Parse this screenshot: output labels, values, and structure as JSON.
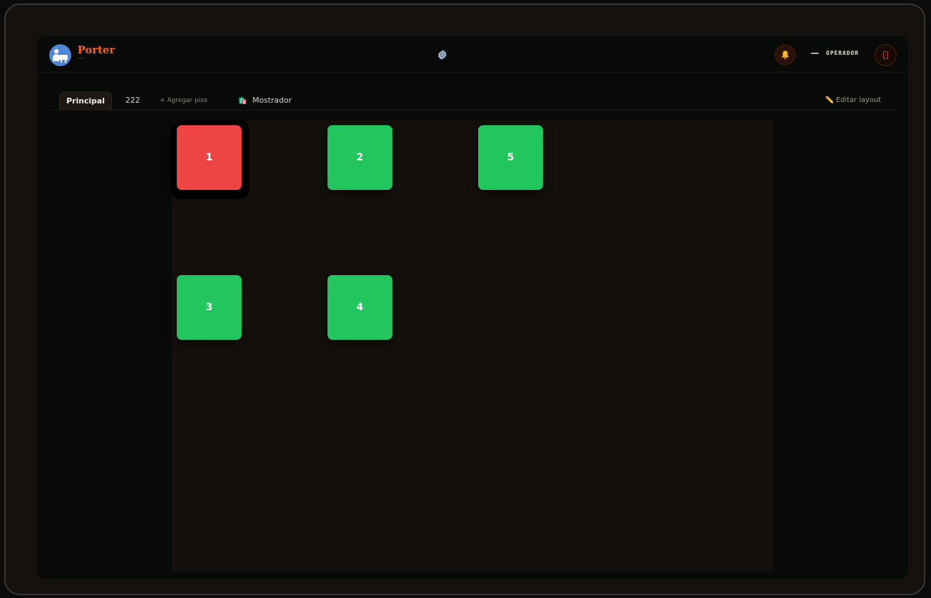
{
  "brand": {
    "name": "Porter",
    "subtitle": "—"
  },
  "header": {
    "settings_icon": "gear-icon",
    "notifications_icon": "bell-icon",
    "user_dash": "—",
    "user_role": "OPERADOR",
    "logout_icon": "logout-icon"
  },
  "tabs": {
    "items": [
      {
        "label": "Principal",
        "active": true
      },
      {
        "label": "222",
        "active": false
      }
    ],
    "add_floor": "+ Agregar piso",
    "counter_icon": "shopping-bag-icon",
    "counter": "Mostrador",
    "edit_layout": "Editar layout",
    "edit_icon": "pencil-icon"
  },
  "tables": [
    {
      "number": "1",
      "status": "occupied",
      "color": "#ef4444"
    },
    {
      "number": "2",
      "status": "free",
      "color": "#22c55e"
    },
    {
      "number": "5",
      "status": "free",
      "color": "#22c55e"
    },
    {
      "number": "3",
      "status": "free",
      "color": "#22c55e"
    },
    {
      "number": "4",
      "status": "free",
      "color": "#22c55e"
    }
  ],
  "colors": {
    "accent": "#f1622a",
    "occupied": "#ef4444",
    "free": "#22c55e",
    "background": "#070a06",
    "canvas": "#14100d"
  }
}
